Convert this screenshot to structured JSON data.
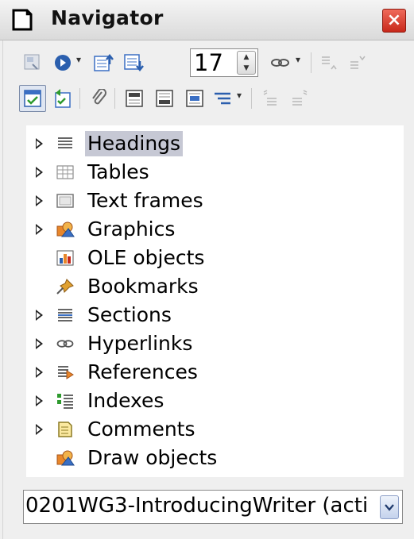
{
  "window": {
    "title": "Navigator",
    "close_label": "×"
  },
  "toolbar": {
    "page_number": "17",
    "spin_up": "▲",
    "spin_down": "▼",
    "dropdown_arrow": "▾"
  },
  "tree": {
    "items": [
      {
        "label": "Headings",
        "icon": "headings-icon",
        "expandable": true,
        "selected": true
      },
      {
        "label": "Tables",
        "icon": "tables-icon",
        "expandable": true
      },
      {
        "label": "Text frames",
        "icon": "text-frames-icon",
        "expandable": true
      },
      {
        "label": "Graphics",
        "icon": "graphics-icon",
        "expandable": true
      },
      {
        "label": "OLE objects",
        "icon": "ole-objects-icon",
        "expandable": false
      },
      {
        "label": "Bookmarks",
        "icon": "bookmarks-icon",
        "expandable": false
      },
      {
        "label": "Sections",
        "icon": "sections-icon",
        "expandable": true
      },
      {
        "label": "Hyperlinks",
        "icon": "hyperlinks-icon",
        "expandable": true
      },
      {
        "label": "References",
        "icon": "references-icon",
        "expandable": true
      },
      {
        "label": "Indexes",
        "icon": "indexes-icon",
        "expandable": true
      },
      {
        "label": "Comments",
        "icon": "comments-icon",
        "expandable": true
      },
      {
        "label": "Draw objects",
        "icon": "draw-objects-icon",
        "expandable": false
      }
    ]
  },
  "document_selector": {
    "value": "0201WG3-IntroducingWriter (acti"
  },
  "colors": {
    "selection": "#c6c8d4",
    "close_button": "#d63a2a",
    "accent_blue": "#3a6fc4"
  }
}
